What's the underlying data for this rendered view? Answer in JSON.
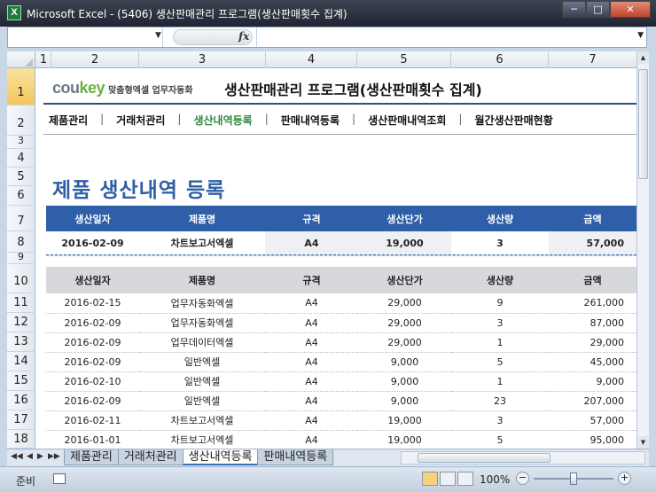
{
  "window": {
    "title": "Microsoft Excel - (5406) 생산판매관리 프로그램(생산판매횟수 집계)"
  },
  "formula_bar": {
    "name_box": "",
    "fx": "fx",
    "value": ""
  },
  "columns": [
    "1",
    "2",
    "3",
    "4",
    "5",
    "6",
    "7"
  ],
  "rows": [
    "1",
    "2",
    "3",
    "4",
    "5",
    "6",
    "7",
    "8",
    "9",
    "10",
    "11",
    "12",
    "13",
    "14",
    "15",
    "16",
    "17",
    "18"
  ],
  "header": {
    "logo_main": "cou",
    "logo_accent": "key",
    "logo_sub": "맞춤형엑셀 업무자동화",
    "title": "생산판매관리 프로그램(생산판매횟수 집계)"
  },
  "nav": {
    "items": [
      "제품관리",
      "거래처관리",
      "생산내역등록",
      "판매내역등록",
      "생산판매내역조회",
      "월간생산판매현황"
    ],
    "separator": "|",
    "active_index": 2
  },
  "page_title": "제품 생산내역 등록",
  "input_table": {
    "headers": [
      "생산일자",
      "제품명",
      "규격",
      "생산단가",
      "생산량",
      "금액"
    ],
    "row": [
      "2016-02-09",
      "차트보고서엑셀",
      "A4",
      "19,000",
      "3",
      "57,000"
    ]
  },
  "list_table": {
    "headers": [
      "생산일자",
      "제품명",
      "규격",
      "생산단가",
      "생산량",
      "금액"
    ],
    "rows": [
      [
        "2016-02-15",
        "업무자동화엑셀",
        "A4",
        "29,000",
        "9",
        "261,000"
      ],
      [
        "2016-02-09",
        "업무자동화엑셀",
        "A4",
        "29,000",
        "3",
        "87,000"
      ],
      [
        "2016-02-09",
        "업무데이터엑셀",
        "A4",
        "29,000",
        "1",
        "29,000"
      ],
      [
        "2016-02-09",
        "일반엑셀",
        "A4",
        "9,000",
        "5",
        "45,000"
      ],
      [
        "2016-02-10",
        "일반엑셀",
        "A4",
        "9,000",
        "1",
        "9,000"
      ],
      [
        "2016-02-09",
        "일반엑셀",
        "A4",
        "9,000",
        "23",
        "207,000"
      ],
      [
        "2016-02-11",
        "차트보고서엑셀",
        "A4",
        "19,000",
        "3",
        "57,000"
      ],
      [
        "2016-01-01",
        "차트보고서엑셀",
        "A4",
        "19,000",
        "5",
        "95,000"
      ]
    ]
  },
  "sheet_tabs": {
    "items": [
      "제품관리",
      "거래처관리",
      "생산내역등록",
      "판매내역등록"
    ],
    "active_index": 2
  },
  "status": {
    "ready": "준비",
    "zoom": "100%"
  },
  "colors": {
    "accent": "#2e5fa8",
    "active_nav": "#2d8a3e",
    "title": "#2f5fa5"
  }
}
